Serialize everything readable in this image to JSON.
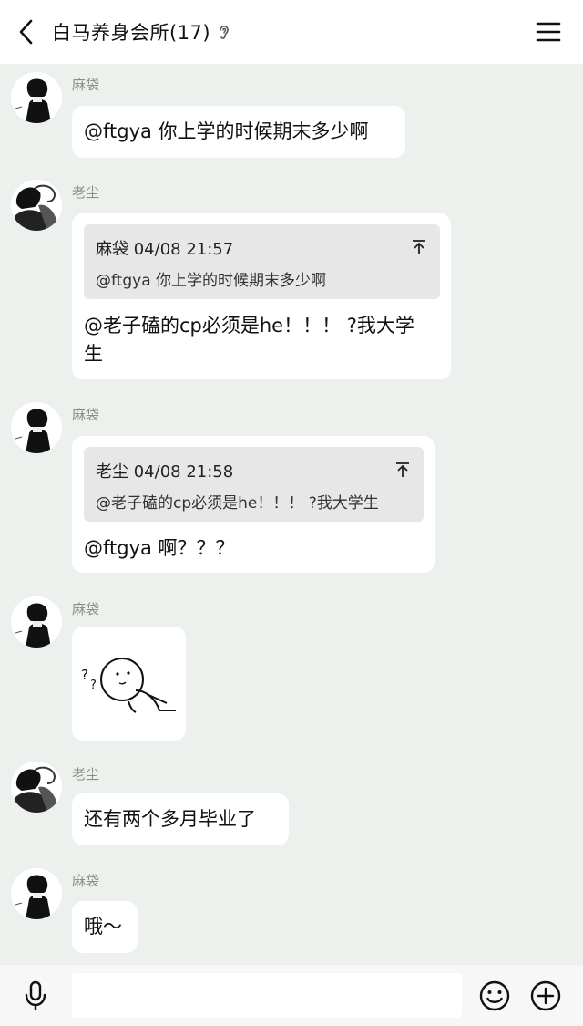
{
  "header": {
    "title": "白马养身会所(17)",
    "back_icon": "chevron-left-icon",
    "ear_icon": "ear-icon",
    "menu_icon": "hamburger-menu-icon"
  },
  "messages": [
    {
      "sender": "麻袋",
      "text": "@ftgya 你上学的时候期末多少啊"
    },
    {
      "sender": "老尘",
      "quote": {
        "meta": "麻袋 04/08 21:57",
        "text": "@ftgya 你上学的时候期末多少啊"
      },
      "text_line1": "@老子磕的cp必须是he！！！ ?我大学",
      "text_line2": "生"
    },
    {
      "sender": "麻袋",
      "quote": {
        "meta": "老尘 04/08 21:58",
        "text": "@老子磕的cp必须是he！！！ ?我大学生"
      },
      "text": "@ftgya 啊？？？"
    },
    {
      "sender": "麻袋",
      "sticker": "confused-stickman-sticker"
    },
    {
      "sender": "老尘",
      "text": "还有两个多月毕业了"
    },
    {
      "sender": "麻袋",
      "text": "哦～"
    }
  ],
  "inputbar": {
    "placeholder": "",
    "voice_icon": "microphone-icon",
    "emoji_icon": "smiley-icon",
    "plus_icon": "plus-circle-icon"
  },
  "colors": {
    "background": "#edf1ee",
    "bubble": "#ffffff",
    "quote_bg": "#e6e7e6",
    "sender_gray": "#8a8f8c"
  }
}
